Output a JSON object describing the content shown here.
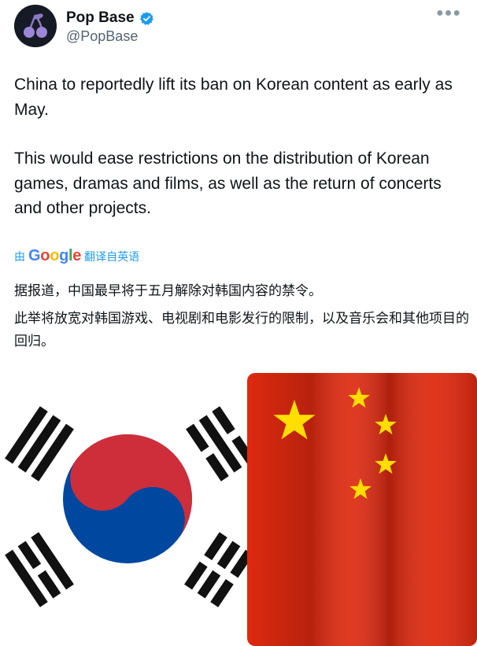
{
  "author": {
    "display_name": "Pop Base",
    "handle": "@PopBase",
    "avatar_icon": "cherry-icon",
    "verified_icon": "verified-badge-icon"
  },
  "more_icon": "more-options-icon",
  "tweet": {
    "paragraphs": [
      "China to reportedly lift its ban on Korean content as early as May.",
      "This would ease restrictions on the distribution of Korean games, dramas and films, as well as the return of concerts and other projects."
    ]
  },
  "translation": {
    "prefix": "由",
    "brand": "Google",
    "suffix": "翻译自英语",
    "paragraphs": [
      "据报道，中国最早将于五月解除对韩国内容的禁令。",
      "此举将放宽对韩国游戏、电视剧和电影发行的限制，以及音乐会和其他项目的回归。"
    ]
  },
  "colors": {
    "text": "#0f1419",
    "muted": "#536471",
    "link": "#1d9bf0",
    "korea_red": "#cd2e3a",
    "korea_blue": "#0047a0",
    "china_red": "#de2910",
    "china_yellow": "#ffde00"
  }
}
